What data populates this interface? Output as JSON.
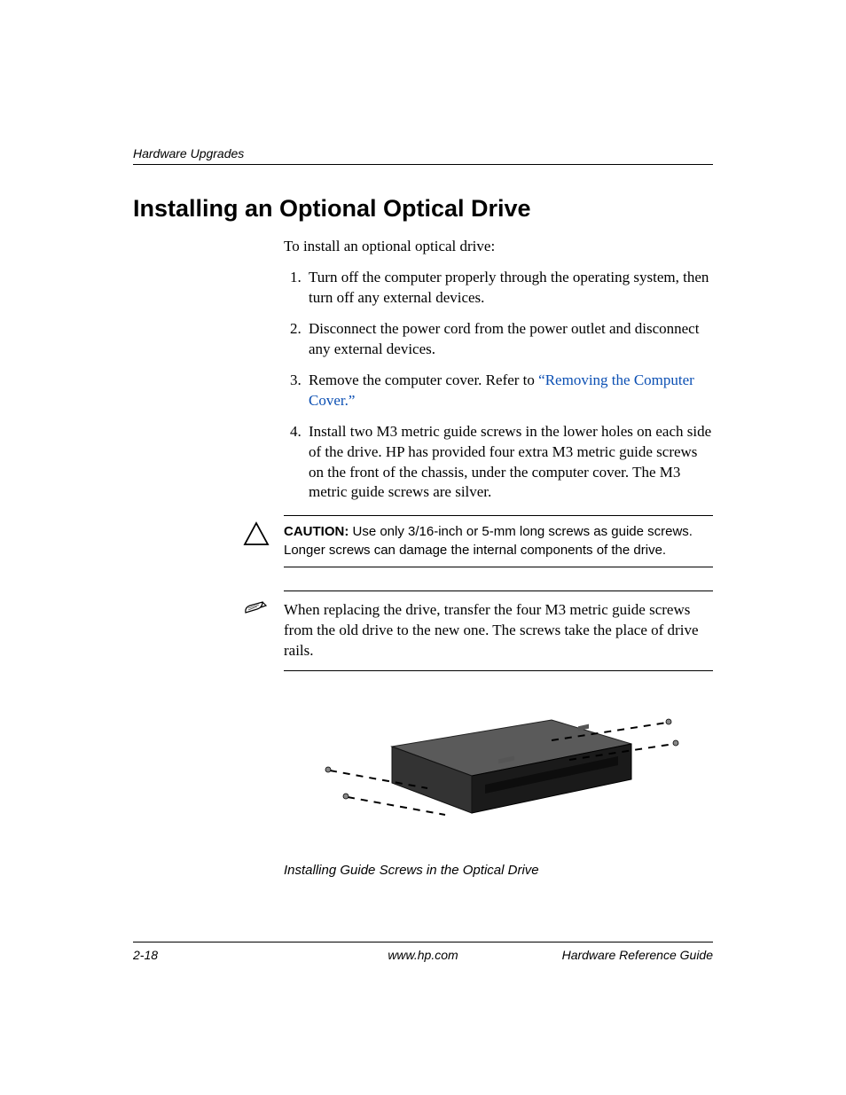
{
  "header": {
    "section": "Hardware Upgrades"
  },
  "title": "Installing an Optional Optical Drive",
  "intro": "To install an optional optical drive:",
  "steps": [
    "Turn off the computer properly through the operating system, then turn off any external devices.",
    "Disconnect the power cord from the power outlet and disconnect any external devices.",
    {
      "pre": "Remove the computer cover. Refer to ",
      "link": "“Removing the Computer Cover.”"
    },
    "Install two M3 metric guide screws in the lower holes on each side of the drive. HP has provided four extra M3 metric guide screws on the front of the chassis, under the computer cover. The M3 metric guide screws are silver."
  ],
  "caution": {
    "label": "CAUTION:",
    "text": " Use only 3/16-inch or 5-mm long screws as guide screws. Longer screws can damage the internal components of the drive."
  },
  "note": "When replacing the drive, transfer the four M3 metric guide screws from the old drive to the new one. The screws take the place of drive rails.",
  "figure_caption": "Installing Guide Screws in the Optical Drive",
  "footer": {
    "page": "2-18",
    "url": "www.hp.com",
    "doc": "Hardware Reference Guide"
  }
}
